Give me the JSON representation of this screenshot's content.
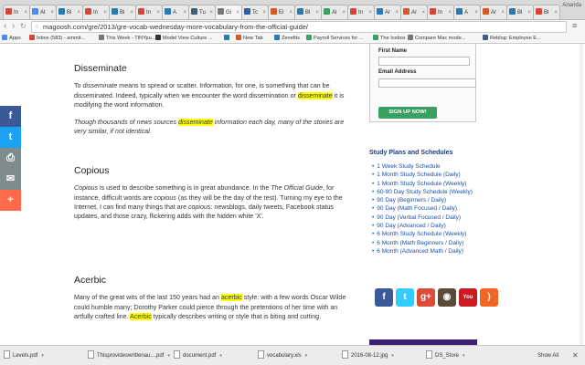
{
  "browser": {
    "tabs": [
      {
        "label": "In",
        "color": "#d44638"
      },
      {
        "label": "At",
        "color": "#4a8cf0"
      },
      {
        "label": "Bi",
        "color": "#2a7ab0"
      },
      {
        "label": "In",
        "color": "#d44638"
      },
      {
        "label": "Bi",
        "color": "#2a7ab0"
      },
      {
        "label": "In",
        "color": "#d44638"
      },
      {
        "label": "A",
        "color": "#2a7ab0"
      },
      {
        "label": "Tu",
        "color": "#3f5b7d"
      },
      {
        "label": "Gi",
        "color": "#777777"
      },
      {
        "label": "Tc",
        "color": "#2e5ea8"
      },
      {
        "label": "El",
        "color": "#d45a2b"
      },
      {
        "label": "Bl",
        "color": "#2a7ab0"
      },
      {
        "label": "Al",
        "color": "#3aa061"
      },
      {
        "label": "In",
        "color": "#d44638"
      },
      {
        "label": "Ar",
        "color": "#2a7ab0"
      },
      {
        "label": "Ar",
        "color": "#d45a2b"
      },
      {
        "label": "In",
        "color": "#d44638"
      },
      {
        "label": "A",
        "color": "#2a7ab0"
      },
      {
        "label": "Ar",
        "color": "#d45a2b"
      },
      {
        "label": "Bl",
        "color": "#2a7ab0"
      },
      {
        "label": "Bl",
        "color": "#d44638"
      }
    ],
    "active_tab_index": 8,
    "user": "Ananda",
    "url": "magoosh.com/gre/2013/gre-vocab-wednesday-more-vocabulary-from-the-official-guide/",
    "bookmarks": [
      {
        "label": "Apps",
        "color": "#4a8cf0"
      },
      {
        "label": "Inbox (583) - ammit...",
        "color": "#d44638"
      },
      {
        "label": "This Week - TINYpu...",
        "color": "#777777"
      },
      {
        "label": "Model View Culture ...",
        "color": "#333333"
      },
      {
        "label": "",
        "color": "#2a7ab0"
      },
      {
        "label": "New Tab",
        "color": "#d45a2b"
      },
      {
        "label": "Zenefits",
        "color": "#2a7ab0"
      },
      {
        "label": "Payroll Services for ...",
        "color": "#3aa061"
      },
      {
        "label": "The Icebox",
        "color": "#3aa061"
      },
      {
        "label": "Compare Mac mode...",
        "color": "#777777"
      },
      {
        "label": "Reblog: Employee E...",
        "color": "#3f5b7d"
      }
    ]
  },
  "share_bar": [
    {
      "icon": "facebook-icon",
      "glyph": "f",
      "color": "#3b5998"
    },
    {
      "icon": "twitter-icon",
      "glyph": "t",
      "color": "#1da1f2"
    },
    {
      "icon": "print-icon",
      "glyph": "⎙",
      "color": "#7f8c8d"
    },
    {
      "icon": "email-icon",
      "glyph": "✉",
      "color": "#7f8c8d"
    },
    {
      "icon": "more-icon",
      "glyph": "+",
      "color": "#ff6b4a"
    }
  ],
  "article": {
    "sections": [
      {
        "title": "Disseminate",
        "p1": [
          {
            "t": "To "
          },
          {
            "t": "disseminate",
            "i": true
          },
          {
            "t": " means to spread or scatter. Information, for one, is something that can be disseminated. Indeed, typically when we encounter the word dissemination or "
          },
          {
            "t": "disseminate",
            "h": true
          },
          {
            "t": " it is modifying the word information."
          }
        ],
        "p2": [
          {
            "t": "Though thousands of news sources ",
            "i": true
          },
          {
            "t": "disseminate",
            "i": true,
            "h": true
          },
          {
            "t": " information each day, many of the stories are very similar, if not identical.",
            "i": true
          }
        ]
      },
      {
        "title": "Copious",
        "p1": [
          {
            "t": "Copious",
            "i": true
          },
          {
            "t": " is used to describe something is in great abundance. In the "
          },
          {
            "t": "The Official Guide",
            "i": true
          },
          {
            "t": ", for instance, difficult words are "
          },
          {
            "t": "copious",
            "i": true
          },
          {
            "t": " (as they will be the day of the test). Turning my eye to the Internet, I can find many things that are "
          },
          {
            "t": "copious",
            "i": true
          },
          {
            "t": ": newsblogs, daily tweets, Facebook status updates, and those crazy, flickering adds with the hidden white 'X'."
          }
        ]
      },
      {
        "title": "Acerbic",
        "p1": [
          {
            "t": "Many of the great wits of the last 150 years had an "
          },
          {
            "t": "acerbic",
            "h": true
          },
          {
            "t": " style: with a few words Oscar Wilde could humble many; Dorothy Parker could pierce through the pretentions of her time with an artfully crafted line. "
          },
          {
            "t": "Acerbic",
            "h": true
          },
          {
            "t": " typically describes writing or style that is biting and cutting."
          }
        ]
      }
    ]
  },
  "signup_form": {
    "first_name_label": "First Name",
    "email_label": "Email Address",
    "button_label": "SIGN UP NOW!"
  },
  "study_plans": {
    "title": "Study Plans and Schedules",
    "items": [
      "1 Week Study Schedule",
      "1 Month Study Schedule (Daily)",
      "1 Month Study Schedule (Weekly)",
      "60-90 Day Study Schedule (Weekly)",
      "90 Day (Beginners / Daily)",
      "90 Day (Math Focused / Daily)",
      "90 Day (Verbal Focused / Daily)",
      "90 Day (Advanced / Daily)",
      "6 Month Study Schedule (Weekly)",
      "6 Month (Math Beginners / Daily)",
      "6 Month (Advanced Math / Daily)"
    ]
  },
  "social_icons": [
    {
      "icon": "facebook-icon",
      "glyph": "f",
      "color": "#3b5998"
    },
    {
      "icon": "twitter-icon",
      "glyph": "t",
      "color": "#33ccff"
    },
    {
      "icon": "google-plus-icon",
      "glyph": "g+",
      "color": "#dd4b39"
    },
    {
      "icon": "instagram-icon",
      "glyph": "◉",
      "color": "#5a4a3a"
    },
    {
      "icon": "youtube-icon",
      "glyph": "You",
      "color": "#cc181e"
    },
    {
      "icon": "rss-icon",
      "glyph": ")",
      "color": "#f26522"
    }
  ],
  "downloads": {
    "items": [
      "Levels.pdf",
      "Thisprovideswrittenau....pdf",
      "document.pdf",
      "vocabulary.xls",
      "2016-08-12.jpg",
      "DS_Store"
    ],
    "show_all": "Show All"
  }
}
